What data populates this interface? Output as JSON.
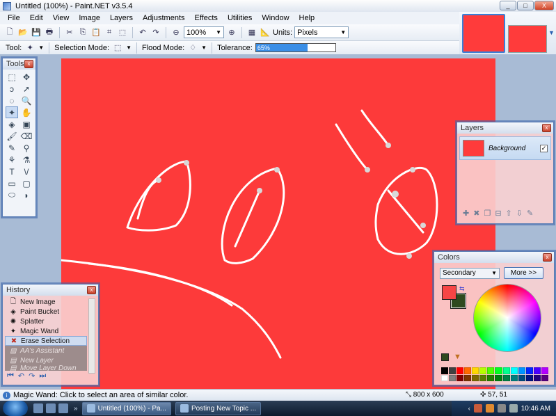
{
  "window": {
    "title": "Untitled (100%) - Paint.NET v3.5.4",
    "buttons": [
      "_",
      "□",
      "X"
    ]
  },
  "menu": [
    "File",
    "Edit",
    "View",
    "Image",
    "Layers",
    "Adjustments",
    "Effects",
    "Utilities",
    "Window",
    "Help"
  ],
  "toolbar1": {
    "zoom": "100%",
    "units_label": "Units:",
    "units_value": "Pixels"
  },
  "toolbar2": {
    "tool_label": "Tool:",
    "selection_mode_label": "Selection Mode:",
    "flood_mode_label": "Flood Mode:",
    "tolerance_label": "Tolerance:",
    "tolerance_value": "65%",
    "tolerance_fraction": 0.65
  },
  "tools_panel": {
    "title": "Tools"
  },
  "history_panel": {
    "title": "History",
    "items": [
      {
        "label": "New Image",
        "icon": "new-image-icon",
        "state": "normal"
      },
      {
        "label": "Paint Bucket",
        "icon": "paint-bucket-icon",
        "state": "normal"
      },
      {
        "label": "Splatter",
        "icon": "splatter-icon",
        "state": "normal"
      },
      {
        "label": "Magic Wand",
        "icon": "magic-wand-icon",
        "state": "normal"
      },
      {
        "label": "Erase Selection",
        "icon": "erase-icon",
        "state": "selected"
      },
      {
        "label": "AA's Assistant",
        "icon": "aa-icon",
        "state": "undone"
      },
      {
        "label": "New Layer",
        "icon": "layer-icon",
        "state": "undone"
      },
      {
        "label": "Move Layer Down",
        "icon": "move-icon",
        "state": "undone"
      }
    ]
  },
  "layers_panel": {
    "title": "Layers",
    "layer_name": "Background",
    "visible": "✓"
  },
  "colors_panel": {
    "title": "Colors",
    "mode": "Secondary",
    "more_button": "More >>",
    "primary_color": "#f74545",
    "secondary_color": "#2f4a1f"
  },
  "status": {
    "message": "Magic Wand: Click to select an area of similar color.",
    "dimensions": "800 x 600",
    "cursor": "57, 51"
  },
  "taskbar": {
    "tasks": [
      "Untitled (100%) - Pa...",
      "Posting New Topic ..."
    ],
    "clock": "10:46 AM"
  },
  "colors": {
    "canvas": "#fd3a3a",
    "workspace": "#a8bbd5"
  }
}
